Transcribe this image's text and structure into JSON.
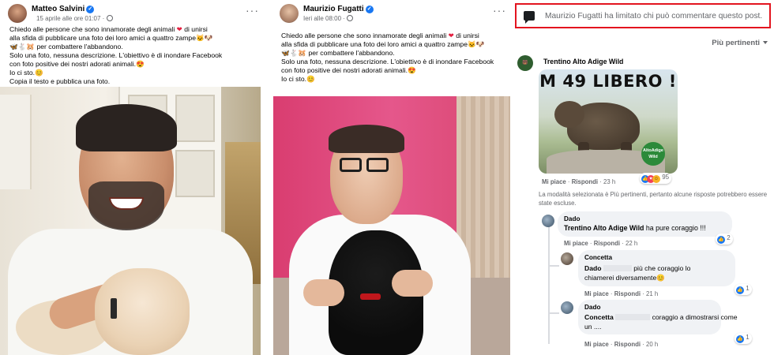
{
  "post_salvini": {
    "author": "Matteo Salvini",
    "timestamp": "15 aprile alle ore 01:07 ·",
    "more": "···",
    "lines": [
      "Chiedo alle persone che sono innamorate degli animali",
      "di unirsi",
      "alla sfida di pubblicare una foto dei loro amici a quattro zampe",
      "per combattere l'abbandono.",
      "Solo una foto, nessuna descrizione. L'obiettivo è di inondare Facebook",
      "con foto positive dei nostri adorati animali.",
      "Io ci sto.",
      "Copia il testo e pubblica una foto."
    ]
  },
  "post_fugatti": {
    "author": "Maurizio Fugatti",
    "timestamp": "Ieri alle 08:00 ·",
    "more": "···",
    "lines": [
      "Chiedo alle persone che sono innamorate degli animali",
      "di unirsi",
      "alla sfida di pubblicare una foto dei loro amici a quattro zampe",
      "per combattere l'abbandono.",
      "Solo una foto, nessuna descrizione. L'obiettivo è di inondare Facebook",
      "con foto positive dei nostri adorati animali.",
      "Io ci sto."
    ]
  },
  "comments_panel": {
    "notice": "Maurizio Fugatti ha limitato chi può commentare questo post.",
    "sort_label": "Più pertinenti",
    "filter_note": "La modalità selezionata è Più pertinenti, pertanto alcune risposte potrebbero essere state escluse.",
    "comment_1": {
      "author": "Trentino Alto Adige Wild",
      "gif_text": "M 49 LIBERO !",
      "gif_logo": "AltoAdige Wild",
      "reactions": "95",
      "like": "Mi piace",
      "reply": "Rispondi",
      "time": "23 h"
    },
    "reply_1": {
      "author": "Dado",
      "mention": "Trentino Alto Adige Wild",
      "text": "ha pure coraggio !!!",
      "reactions": "2",
      "like": "Mi piace",
      "reply": "Rispondi",
      "time": "22 h"
    },
    "reply_2": {
      "author": "Concetta",
      "mention": "Dado",
      "text_1": "più che coraggio lo",
      "text_2": "chiamerei diversamente",
      "reactions": "1",
      "like": "Mi piace",
      "reply": "Rispondi",
      "time": "21 h"
    },
    "reply_3": {
      "author": "Dado",
      "mention": "Concetta",
      "text_1": "coraggio a dimostrarsi come",
      "text_2": "un ....",
      "reactions": "1",
      "like": "Mi piace",
      "reply": "Rispondi",
      "time": "20 h"
    }
  },
  "colors": {
    "notice_border": "#e3141f",
    "facebook_blue": "#1877f2",
    "meta_gray": "#65676b",
    "bubble_bg": "#f0f2f5"
  }
}
